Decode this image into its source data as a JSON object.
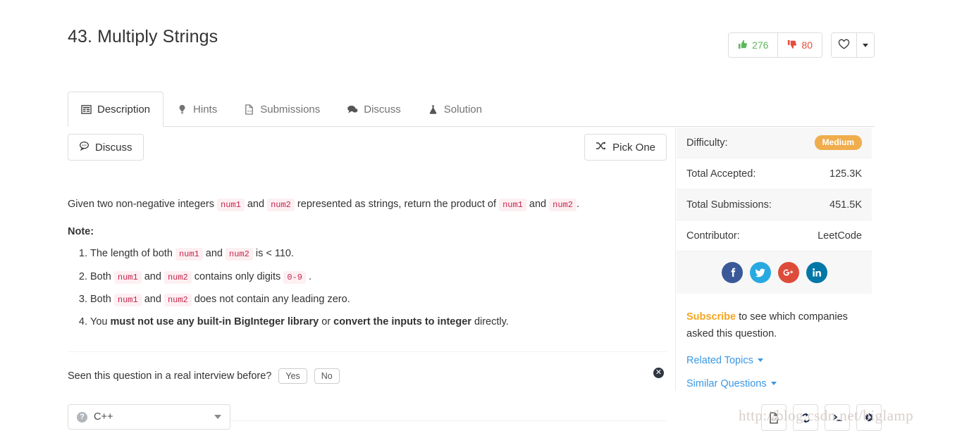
{
  "problem": {
    "title": "43. Multiply Strings",
    "upvotes": "276",
    "downvotes": "80"
  },
  "tabs": [
    {
      "label": "Description",
      "icon": "list-icon",
      "active": true
    },
    {
      "label": "Hints",
      "icon": "lightbulb-icon",
      "active": false
    },
    {
      "label": "Submissions",
      "icon": "file-code-icon",
      "active": false
    },
    {
      "label": "Discuss",
      "icon": "chat-icon",
      "active": false
    },
    {
      "label": "Solution",
      "icon": "flask-icon",
      "active": false
    }
  ],
  "actions": {
    "discuss_label": "Discuss",
    "pick_one_label": "Pick One"
  },
  "description": {
    "intro_part1": "Given two non-negative integers",
    "code_num1_a": "num1",
    "intro_and1": "and",
    "code_num2_a": "num2",
    "intro_part2": "represented as strings, return the product of",
    "code_num1_b": "num1",
    "intro_and2": "and",
    "code_num2_b": "num2",
    "intro_end": ".",
    "note_heading": "Note:",
    "notes": [
      {
        "pre": "The length of both",
        "code1": "num1",
        "mid": "and",
        "code2": "num2",
        "post": "is < 110."
      },
      {
        "pre": "Both",
        "code1": "num1",
        "mid": "and",
        "code2": "num2",
        "post": "contains only digits",
        "code3": "0-9",
        "tail": "."
      },
      {
        "pre": "Both",
        "code1": "num1",
        "mid": "and",
        "code2": "num2",
        "post": "does not contain any leading zero."
      },
      {
        "pre": "You",
        "bold1": "must not use any built-in BigInteger library",
        "mid": "or",
        "bold2": "convert the inputs to integer",
        "post": "directly."
      }
    ]
  },
  "interview_prompt": {
    "question": "Seen this question in a real interview before?",
    "yes_label": "Yes",
    "no_label": "No",
    "close_label": "✕"
  },
  "sidebar": {
    "stats": [
      {
        "label": "Difficulty:",
        "value": "Medium",
        "is_badge": true
      },
      {
        "label": "Total Accepted:",
        "value": "125.3K",
        "is_badge": false
      },
      {
        "label": "Total Submissions:",
        "value": "451.5K",
        "is_badge": false
      },
      {
        "label": "Contributor:",
        "value": "LeetCode",
        "is_badge": false
      }
    ],
    "social": [
      {
        "name": "facebook-icon",
        "color": "#3b5998",
        "glyph": "f"
      },
      {
        "name": "twitter-icon",
        "color": "#29a9e1",
        "glyph": "t"
      },
      {
        "name": "googleplus-icon",
        "color": "#dd4b39",
        "glyph": "G+"
      },
      {
        "name": "linkedin-icon",
        "color": "#0077a7",
        "glyph": "in"
      }
    ],
    "subscribe_link": "Subscribe",
    "subscribe_text": " to see which companies asked this question.",
    "related_topics": "Related Topics",
    "similar_questions": "Similar Questions"
  },
  "editor_bar": {
    "language": "C++",
    "help_glyph": "?",
    "tools": [
      {
        "name": "code-file-icon"
      },
      {
        "name": "reset-icon"
      },
      {
        "name": "console-icon"
      },
      {
        "name": "settings-gear-icon"
      }
    ]
  },
  "watermark": "http://blog.csdn.net/biglamp",
  "colors": {
    "upvote": "#5cb85c",
    "downvote": "#e74c3c",
    "difficulty_medium": "#f0ad4e",
    "link": "#3b97e3",
    "subscribe": "#f5a623",
    "inline_code_text": "#c7254e",
    "inline_code_bg": "#fdeff2"
  }
}
